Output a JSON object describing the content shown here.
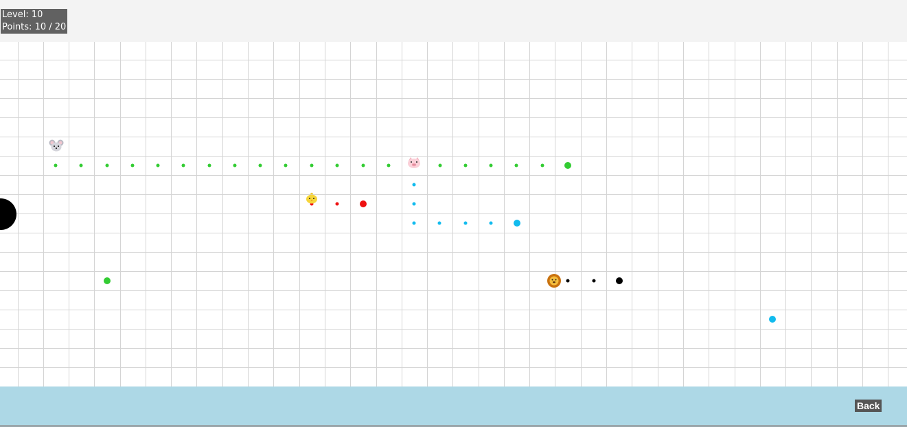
{
  "hud": {
    "level_text": "Level: 10",
    "points_text": "Points: 10 / 20",
    "level": 10,
    "points": 10,
    "points_goal": 20
  },
  "footer": {
    "back_label": "Back"
  },
  "colors": {
    "green": "#33cc33",
    "red": "#ee1111",
    "blue": "#11bbee",
    "black": "#000000",
    "grid": "#d4d4d4",
    "footer_bg": "#add8e6",
    "header_bg": "#f3f3f3"
  },
  "icons": {
    "mouse": "mouse-face-icon",
    "pig": "pig-face-icon",
    "chick": "chick-icon",
    "lion": "lion-face-icon",
    "hole": "black-hole-icon"
  }
}
